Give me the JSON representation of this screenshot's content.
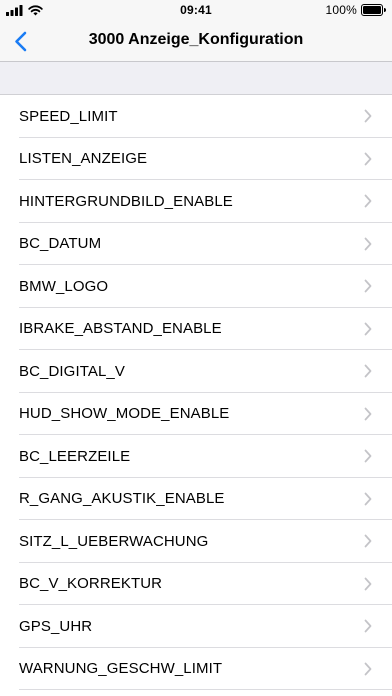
{
  "status_bar": {
    "time": "09:41",
    "battery_percent": "100%",
    "icons": [
      "signal-bars-icon",
      "wifi-icon",
      "battery-icon"
    ]
  },
  "nav": {
    "title": "3000 Anzeige_Konfiguration",
    "back_icon": "chevron-left-icon",
    "accent_color": "#1a7cf4"
  },
  "list": {
    "items": [
      {
        "label": "SPEED_LIMIT"
      },
      {
        "label": "LISTEN_ANZEIGE"
      },
      {
        "label": "HINTERGRUNDBILD_ENABLE"
      },
      {
        "label": "BC_DATUM"
      },
      {
        "label": "BMW_LOGO"
      },
      {
        "label": "IBRAKE_ABSTAND_ENABLE"
      },
      {
        "label": "BC_DIGITAL_V"
      },
      {
        "label": "HUD_SHOW_MODE_ENABLE"
      },
      {
        "label": "BC_LEERZEILE"
      },
      {
        "label": "R_GANG_AKUSTIK_ENABLE"
      },
      {
        "label": "SITZ_L_UEBERWACHUNG"
      },
      {
        "label": "BC_V_KORREKTUR"
      },
      {
        "label": "GPS_UHR"
      },
      {
        "label": "WARNUNG_GESCHW_LIMIT"
      }
    ],
    "disclosure_icon": "chevron-right-icon",
    "disclosure_color": "#c4c4c8"
  }
}
